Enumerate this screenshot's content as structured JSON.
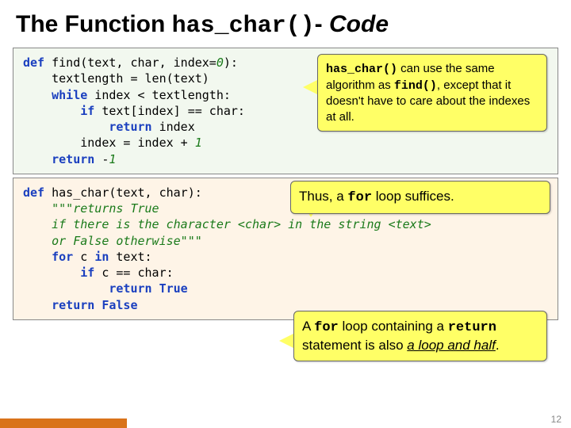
{
  "title": {
    "prefix": "The Function ",
    "mono": "has_char()",
    "suffix": "- ",
    "ital": "Code"
  },
  "code1": {
    "l1a": "def",
    "l1b": " find(text, char, index=",
    "l1c": "0",
    "l1d": "):",
    "l2": "    textlength = len(text)",
    "l3a": "    ",
    "l3b": "while",
    "l3c": " index < textlength:",
    "l4a": "        ",
    "l4b": "if",
    "l4c": " text[index] == char:",
    "l5a": "            ",
    "l5b": "return",
    "l5c": " index",
    "l6a": "        index = index + ",
    "l6b": "1",
    "l7a": "    ",
    "l7b": "return",
    "l7c": " -",
    "l7d": "1"
  },
  "code2": {
    "l1a": "def",
    "l1b": " has_char(text, char):",
    "l2": "    \"\"\"returns True",
    "l3": "    if there is the character <char> in the string <text>",
    "l4": "    or False otherwise\"\"\"",
    "l5a": "    ",
    "l5b": "for",
    "l5c": " c ",
    "l5d": "in",
    "l5e": " text:",
    "l6a": "        ",
    "l6b": "if",
    "l6c": " c == char:",
    "l7a": "            ",
    "l7b": "return True",
    "l8a": "    ",
    "l8b": "return False"
  },
  "callout1": {
    "p1a": "has_char()",
    "p1b": " can use the same algorithm as ",
    "p1c": "find()",
    "p1d": ", except that it doesn't have to care about the indexes at all."
  },
  "callout2": {
    "t1": "Thus, a ",
    "t2": "for",
    "t3": " loop suffices."
  },
  "callout3": {
    "t1": "A ",
    "t2": "for",
    "t3": " loop containing a ",
    "t4": "return",
    "t5": " statement is also ",
    "t6": "a loop and half",
    "t7": "."
  },
  "page": "12"
}
